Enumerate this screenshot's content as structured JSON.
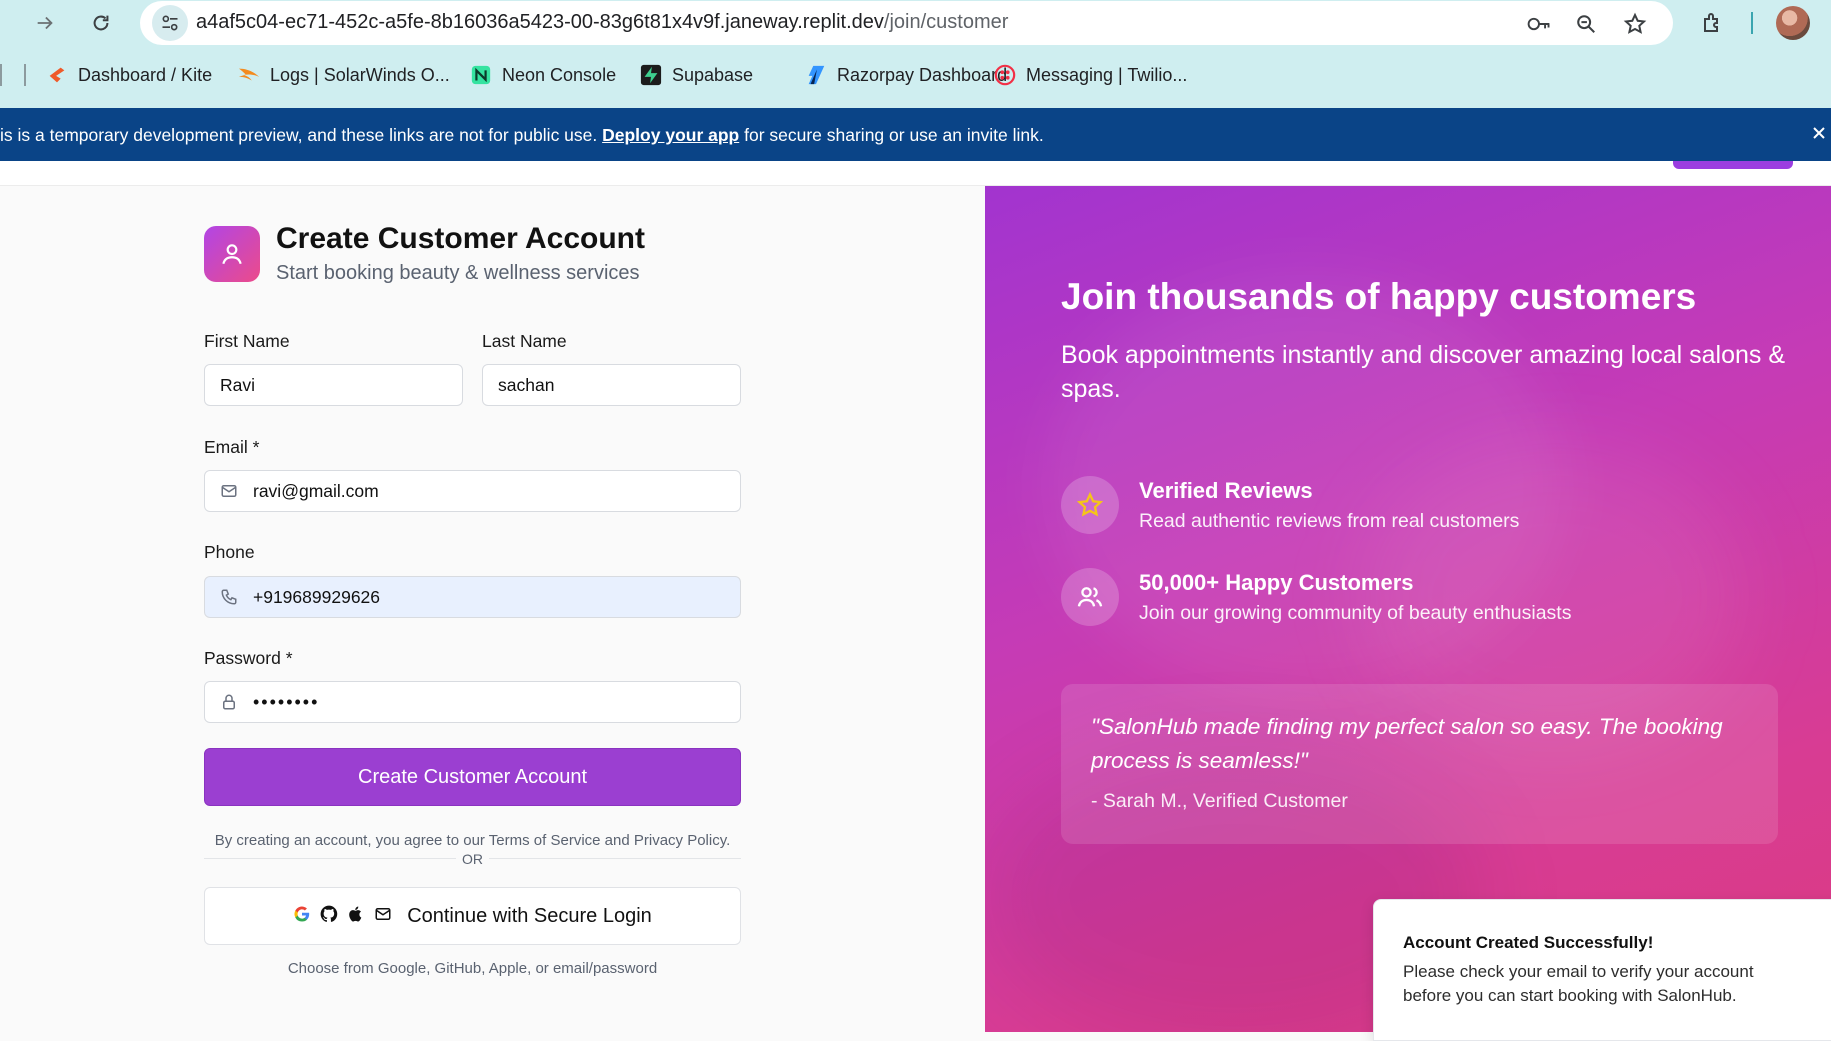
{
  "browser": {
    "url_host": "a4af5c04-ec71-452c-a5fe-8b16036a5423-00-83g6t81x4v9f.janeway.replit.dev",
    "url_path": "/join/customer",
    "bookmarks": [
      {
        "label": "Dashboard / Kite",
        "icon": "kite-icon"
      },
      {
        "label": "Logs | SolarWinds O...",
        "icon": "solarwinds-icon"
      },
      {
        "label": "Neon Console",
        "icon": "neon-icon"
      },
      {
        "label": "Supabase",
        "icon": "supabase-icon"
      },
      {
        "label": "Razorpay Dashboard",
        "icon": "razorpay-icon"
      },
      {
        "label": "Messaging | Twilio...",
        "icon": "twilio-icon"
      }
    ]
  },
  "banner": {
    "text_before": "is is a temporary development preview, and these links are not for public use. ",
    "link": "Deploy your app",
    "text_after": " for secure sharing or use an invite link."
  },
  "form": {
    "title": "Create Customer Account",
    "subtitle": "Start booking beauty & wellness services",
    "first_name_label": "First Name",
    "first_name_value": "Ravi",
    "last_name_label": "Last Name",
    "last_name_value": "sachan",
    "email_label": "Email *",
    "email_value": "ravi@gmail.com",
    "phone_label": "Phone",
    "phone_value": "+919689929626",
    "password_label": "Password *",
    "password_value": "••••••••",
    "submit_label": "Create Customer Account",
    "terms": "By creating an account, you agree to our Terms of Service and Privacy Policy.",
    "or": "OR",
    "oauth_label": "Continue with Secure Login",
    "oauth_note": "Choose from Google, GitHub, Apple, or email/password"
  },
  "promo": {
    "title": "Join thousands of happy customers",
    "subtitle": "Book appointments instantly and discover amazing local salons & spas.",
    "features": [
      {
        "title": "Verified Reviews",
        "desc": "Read authentic reviews from real customers",
        "icon": "star-icon"
      },
      {
        "title": "50,000+ Happy Customers",
        "desc": "Join our growing community of beauty enthusiasts",
        "icon": "users-icon"
      }
    ],
    "quote": "\"SalonHub made finding my perfect salon so easy. The booking process is seamless!\"",
    "quote_author": "- Sarah M., Verified Customer"
  },
  "toast": {
    "title": "Account Created Successfully!",
    "body": "Please check your email to verify your account before you can start booking with SalonHub."
  },
  "colors": {
    "primary": "#9b3fd1",
    "banner": "#0a4487",
    "chrome": "#cfeef0",
    "star": "#f5c518"
  }
}
